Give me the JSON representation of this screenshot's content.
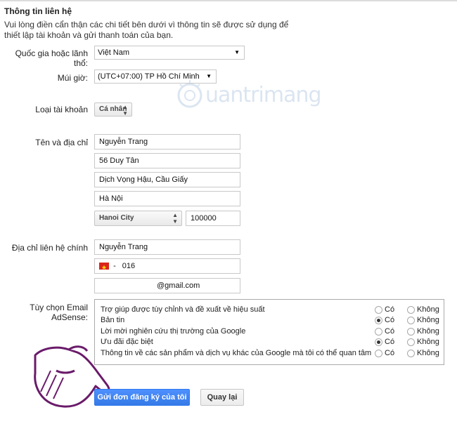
{
  "section_title": "Thông tin liên hệ",
  "intro": "Vui lòng điền cẩn thận các chi tiết bên dưới vì thông tin sẽ được sử dụng để thiết lập tài khoản và gửi thanh toán của bạn.",
  "country": {
    "label": "Quốc gia hoặc lãnh thổ:",
    "value": "Việt Nam"
  },
  "timezone": {
    "label": "Múi giờ:",
    "value": "(UTC+07:00) TP Hồ Chí Minh"
  },
  "account_type": {
    "label": "Loại tài khoản",
    "value": "Cá nhân"
  },
  "name_address": {
    "label": "Tên và địa chỉ",
    "name": "Nguyễn Trang",
    "line1": "56 Duy Tân",
    "line2": "Dịch Vọng Hậu, Cầu Giấy",
    "city": "Hà Nội",
    "province": "Hanoi City",
    "postal": "100000"
  },
  "contact": {
    "label": "Địa chỉ liên hệ chính",
    "name": "Nguyễn Trang",
    "phone_prefix": "-",
    "phone": "016",
    "email": "@gmail.com"
  },
  "email_options": {
    "label_line1": "Tùy chọn Email",
    "label_line2": "AdSense:",
    "yes_label": "Có",
    "no_label": "Không",
    "items": [
      {
        "text": "Trợ giúp được tùy chỉnh và đề xuất về hiệu suất",
        "selected": "none"
      },
      {
        "text": "Bản tin",
        "selected": "yes"
      },
      {
        "text": "Lời mời nghiên cứu thị trường của Google",
        "selected": "none"
      },
      {
        "text": "Ưu đãi đặc biệt",
        "selected": "yes"
      },
      {
        "text": "Thông tin về các sản phẩm và dịch vụ khác của Google mà tôi có thể quan tâm",
        "selected": "none"
      }
    ]
  },
  "submit_label": "Gửi đơn đăng ký của tôi",
  "back_label": "Quay lại",
  "watermark_text": "uantrimang"
}
